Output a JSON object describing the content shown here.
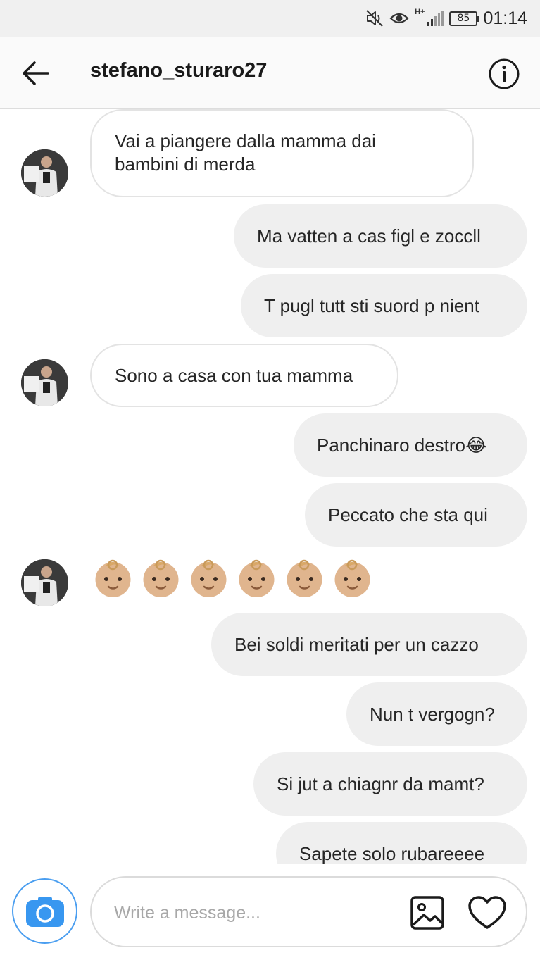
{
  "status_bar": {
    "battery": "85",
    "network": "H+",
    "time": "01:14",
    "icons": [
      "mute-icon",
      "eye-icon",
      "signal-icon",
      "battery-icon"
    ]
  },
  "header": {
    "username": "stefano_sturaro27",
    "icons": [
      "back-arrow-icon",
      "info-icon"
    ]
  },
  "messages": [
    {
      "side": "in",
      "text": "Vai a piangere dalla mamma dai\nbambini di merda"
    },
    {
      "side": "out",
      "text": "Ma vatten a cas figl e zoccll"
    },
    {
      "side": "out",
      "text": "T pugl tutt sti suord p nient"
    },
    {
      "side": "in",
      "text": "Sono a casa con tua mamma"
    },
    {
      "side": "out",
      "text": "Panchinaro destro😂"
    },
    {
      "side": "out",
      "text": "Peccato che sta qui"
    },
    {
      "side": "in",
      "emoji": "baby-emoji",
      "count": 6
    },
    {
      "side": "out",
      "text": "Bei soldi meritati per un cazzo"
    },
    {
      "side": "out",
      "text": "Nun t vergogn?"
    },
    {
      "side": "out",
      "text": "Si jut a chiagnr da mamt?"
    },
    {
      "side": "out",
      "text": "Sapete  solo rubareeee"
    }
  ],
  "composer": {
    "placeholder": "Write a message...",
    "icons": [
      "camera-icon",
      "gallery-icon",
      "heart-icon"
    ]
  },
  "colors": {
    "accent": "#3897f0",
    "outgoing_bubble": "#efefef",
    "incoming_border": "#e3e3e3",
    "status_bar_bg": "#f0f0f0"
  }
}
